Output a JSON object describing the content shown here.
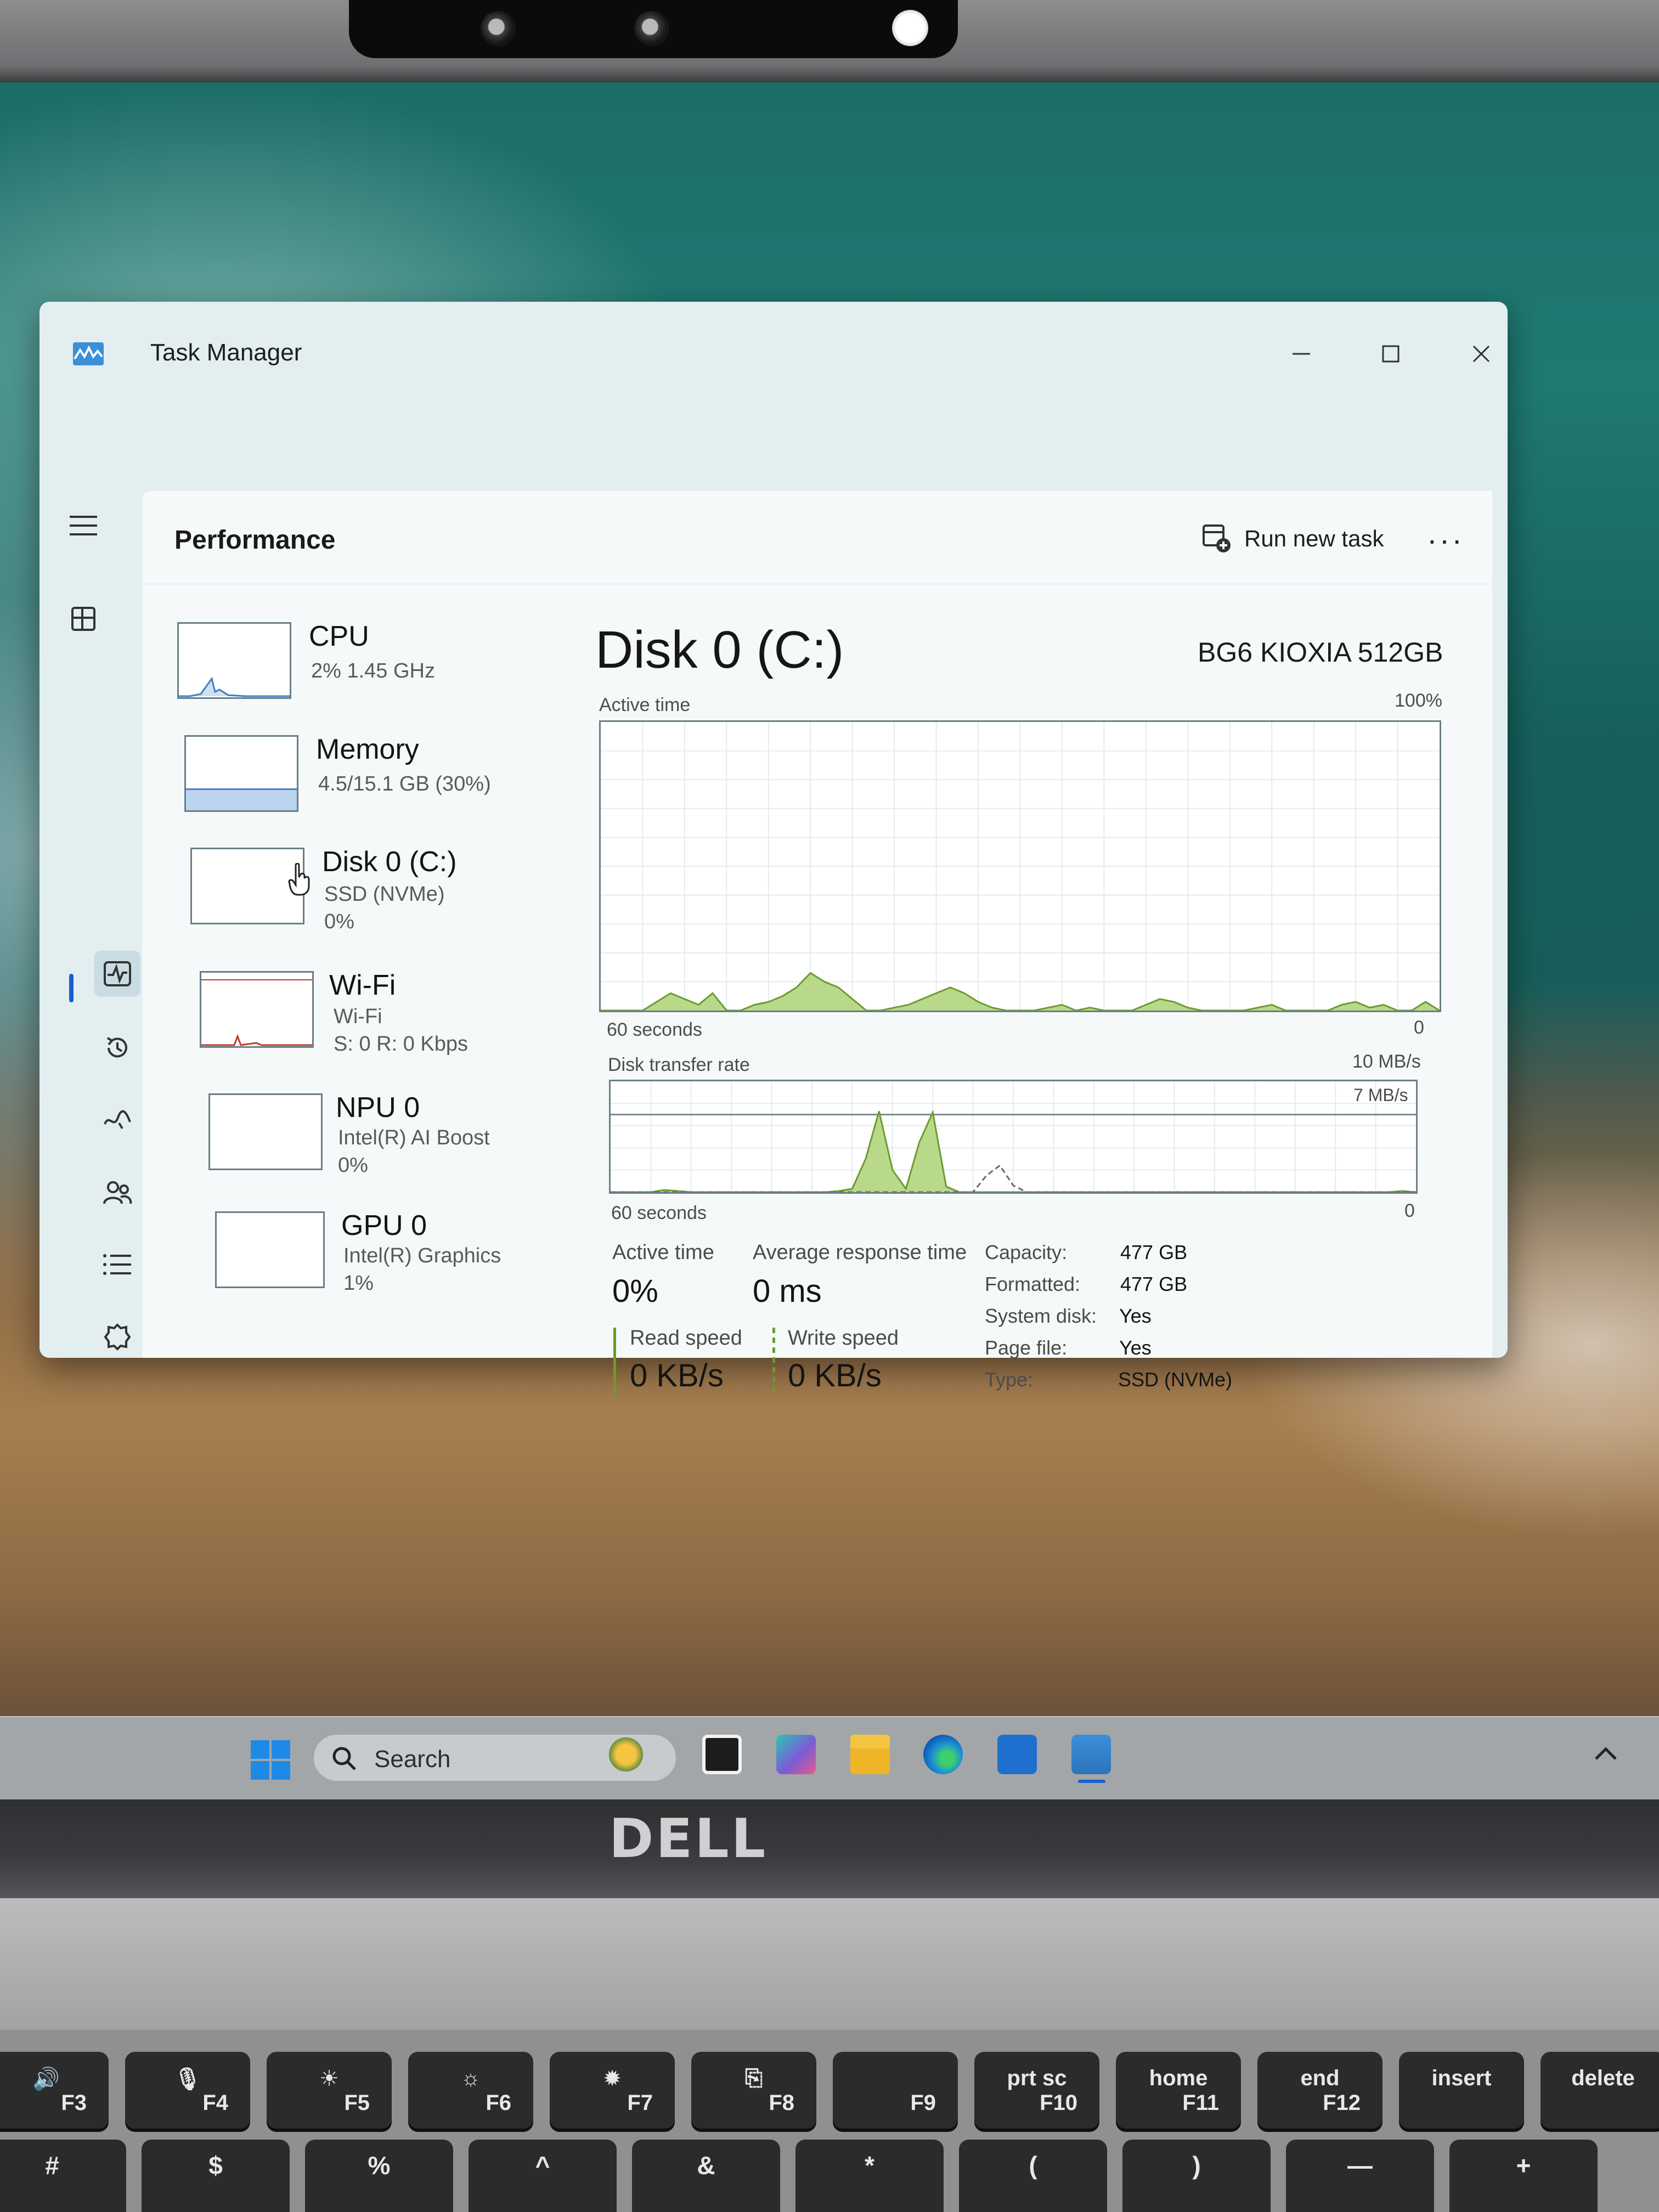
{
  "window": {
    "title": "Task Manager",
    "minimize_glyph": "—",
    "maximize_glyph": "☐",
    "close_glyph": "✕"
  },
  "header": {
    "page_title": "Performance",
    "run_new_task": "Run new task",
    "more": "···"
  },
  "nav": {
    "items": [
      {
        "icon": "hamburger-icon"
      },
      {
        "icon": "processes-icon"
      },
      {
        "icon": "performance-icon",
        "active": true
      },
      {
        "icon": "app-history-icon"
      },
      {
        "icon": "startup-apps-icon"
      },
      {
        "icon": "users-icon"
      },
      {
        "icon": "details-icon"
      },
      {
        "icon": "services-icon"
      },
      {
        "icon": "settings-icon"
      }
    ]
  },
  "resources": [
    {
      "name": "CPU",
      "sub1": "2% 1.45 GHz"
    },
    {
      "name": "Memory",
      "sub1": "4.5/15.1 GB (30%)"
    },
    {
      "name": "Disk 0 (C:)",
      "sub1": "SSD (NVMe)",
      "sub2": "0%",
      "selected": true
    },
    {
      "name": "Wi-Fi",
      "sub1": "Wi-Fi",
      "sub2": "S: 0 R: 0 Kbps"
    },
    {
      "name": "NPU 0",
      "sub1": "Intel(R) AI Boost",
      "sub2": "0%"
    },
    {
      "name": "GPU 0",
      "sub1": "Intel(R) Graphics",
      "sub2": "1%"
    }
  ],
  "detail": {
    "title": "Disk 0 (C:)",
    "model": "BG6 KIOXIA 512GB",
    "active_time_graph": {
      "label": "Active time",
      "max": "100%",
      "time": "60 seconds",
      "min": "0"
    },
    "transfer_graph": {
      "label": "Disk transfer rate",
      "max": "10 MB/s",
      "marker": "7 MB/s",
      "time": "60 seconds",
      "min": "0"
    },
    "stats": {
      "active_time_label": "Active time",
      "active_time_value": "0%",
      "avg_response_label": "Average response time",
      "avg_response_value": "0 ms",
      "read_speed_label": "Read speed",
      "read_speed_value": "0 KB/s",
      "write_speed_label": "Write speed",
      "write_speed_value": "0 KB/s"
    },
    "properties": [
      {
        "label": "Capacity:",
        "value": "477 GB"
      },
      {
        "label": "Formatted:",
        "value": "477 GB"
      },
      {
        "label": "System disk:",
        "value": "Yes"
      },
      {
        "label": "Page file:",
        "value": "Yes"
      },
      {
        "label": "Type:",
        "value": "SSD (NVMe)"
      }
    ]
  },
  "chart_data": [
    {
      "type": "area",
      "title": "Active time",
      "ylim": [
        0,
        100
      ],
      "x_range_seconds": [
        0,
        60
      ],
      "x": [
        0,
        1,
        2,
        3,
        4,
        5,
        6,
        7,
        8,
        9,
        10,
        11,
        12,
        13,
        14,
        15,
        16,
        17,
        18,
        19,
        20,
        21,
        22,
        23,
        24,
        25,
        26,
        27,
        28,
        29,
        30,
        31,
        32,
        33,
        34,
        35,
        36,
        37,
        38,
        39,
        40,
        41,
        42,
        43,
        44,
        45,
        46,
        47,
        48,
        49,
        50,
        51,
        52,
        53,
        54,
        55,
        56,
        57,
        58,
        59,
        60
      ],
      "values": [
        0,
        0,
        0,
        0,
        3,
        6,
        4,
        2,
        6,
        0,
        0,
        2,
        3,
        5,
        8,
        13,
        10,
        8,
        4,
        0,
        0,
        1,
        2,
        4,
        6,
        8,
        6,
        3,
        1,
        0,
        0,
        0,
        1,
        2,
        0,
        1,
        0,
        0,
        0,
        2,
        4,
        3,
        1,
        0,
        0,
        0,
        0,
        1,
        2,
        0,
        0,
        0,
        0,
        2,
        3,
        1,
        2,
        0,
        0,
        3,
        0
      ]
    },
    {
      "type": "area",
      "title": "Disk transfer rate",
      "ylim": [
        0,
        10
      ],
      "unit": "MB/s",
      "x_range_seconds": [
        0,
        60
      ],
      "series": [
        {
          "values": [
            0,
            0,
            0,
            0,
            0.2,
            0.1,
            0,
            0,
            0,
            0,
            0,
            0,
            0,
            0,
            0,
            0,
            0,
            0.1,
            0.3,
            3.0,
            7.3,
            2.0,
            0.3,
            4.5,
            7.2,
            0.5,
            0,
            0,
            0,
            0,
            0,
            0,
            0,
            0,
            0,
            0,
            0,
            0,
            0,
            0,
            0,
            0,
            0,
            0,
            0,
            0,
            0,
            0,
            0,
            0,
            0,
            0,
            0,
            0,
            0,
            0,
            0,
            0,
            0,
            0.1,
            0
          ]
        },
        {
          "values": [
            0,
            0,
            0,
            0,
            0,
            0,
            0,
            0,
            0,
            0,
            0,
            0,
            0,
            0,
            0,
            0,
            0,
            0,
            0,
            0,
            0,
            0,
            0,
            0,
            0,
            0,
            0,
            0,
            0,
            0,
            0,
            0,
            0,
            0,
            0,
            0,
            0,
            0,
            0,
            0,
            0,
            0,
            0,
            0,
            0,
            0,
            0,
            0,
            0,
            0,
            0,
            0,
            0,
            0,
            0,
            0,
            0,
            0,
            0,
            0,
            0
          ]
        },
        {
          "values": [
            0,
            0,
            0,
            0,
            0,
            0,
            0,
            0,
            0,
            0,
            0,
            0,
            0,
            0,
            0,
            0,
            0,
            0,
            0,
            0,
            0,
            0,
            0,
            0,
            0,
            0,
            0,
            0,
            1.5,
            2.4,
            0.6,
            0,
            0,
            0,
            0,
            0,
            0,
            0,
            0,
            0,
            0,
            0,
            0,
            0,
            0,
            0,
            0,
            0,
            0,
            0,
            0,
            0,
            0,
            0,
            0,
            0,
            0,
            0,
            0,
            0,
            0
          ]
        }
      ]
    }
  ],
  "taskbar": {
    "search_placeholder": "Search"
  },
  "device": {
    "brand": "DELL"
  },
  "keyboard": {
    "fn_row": [
      {
        "main": "🔊",
        "sub": "F3"
      },
      {
        "main": "🎙",
        "sub": "F4"
      },
      {
        "main": "☀",
        "sub": "F5"
      },
      {
        "main": "☼",
        "sub": "F6"
      },
      {
        "main": "✹",
        "sub": "F7"
      },
      {
        "main": "⎘",
        "sub": "F8"
      },
      {
        "main": "",
        "sub": "F9"
      },
      {
        "main": "prt sc",
        "sub": "F10"
      },
      {
        "main": "home",
        "sub": "F11"
      },
      {
        "main": "end",
        "sub": "F12"
      },
      {
        "main": "insert",
        "sub": ""
      },
      {
        "main": "delete",
        "sub": ""
      }
    ],
    "number_row": [
      "#",
      "$",
      "%",
      "^",
      "&",
      "*",
      "(",
      ")",
      "—",
      "+"
    ]
  },
  "colors": {
    "graph_fill": "#b9d98a",
    "graph_line": "#6d9a2f",
    "grid": "#e4ecee",
    "accent": "#1a5fd0",
    "wifi_spike": "#c0392b"
  }
}
